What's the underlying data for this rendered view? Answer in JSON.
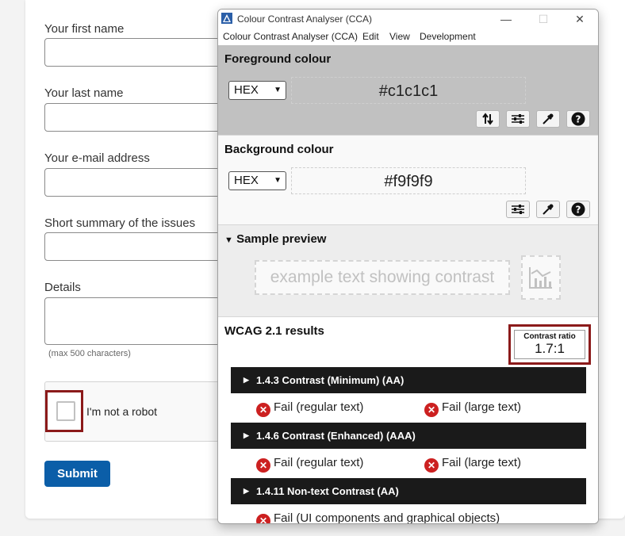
{
  "form": {
    "first_name_label": "Your first name",
    "last_name_label": "Your last name",
    "email_label": "Your e-mail address",
    "summary_label": "Short summary of the issues",
    "details_label": "Details",
    "details_hint": "(max 500 characters)",
    "captcha_label": "I'm not a robot",
    "submit_label": "Submit"
  },
  "cca": {
    "window_title": "Colour Contrast Analyser (CCA)",
    "menu": [
      "Colour Contrast Analyser (CCA)",
      "Edit",
      "View",
      "Development"
    ],
    "foreground": {
      "title": "Foreground colour",
      "format": "HEX",
      "value": "#c1c1c1",
      "color": "#c1c1c1"
    },
    "background": {
      "title": "Background colour",
      "format": "HEX",
      "value": "#f9f9f9",
      "color": "#f9f9f9"
    },
    "preview": {
      "title": "Sample preview",
      "sample_text": "example text showing contrast"
    },
    "results": {
      "title": "WCAG 2.1 results",
      "ratio_label": "Contrast ratio",
      "ratio_value": "1.7:1",
      "criteria": [
        {
          "label": "1.4.3 Contrast (Minimum) (AA)",
          "results": [
            "Fail (regular text)",
            "Fail (large text)"
          ]
        },
        {
          "label": "1.4.6 Contrast (Enhanced) (AAA)",
          "results": [
            "Fail (regular text)",
            "Fail (large text)"
          ]
        },
        {
          "label": "1.4.11 Non-text Contrast (AA)",
          "results": [
            "Fail (UI components and graphical objects)"
          ]
        }
      ]
    }
  },
  "icons": {
    "swap": "swap-arrows-icon",
    "sliders": "sliders-icon",
    "eyedropper": "eyedropper-icon",
    "help": "help-icon",
    "fail": "fail-x-icon"
  },
  "colors": {
    "highlight": "#8b1a1a",
    "submit": "#0b5ea8",
    "fail": "#cc2020",
    "criterion_bar": "#1a1a1a"
  }
}
